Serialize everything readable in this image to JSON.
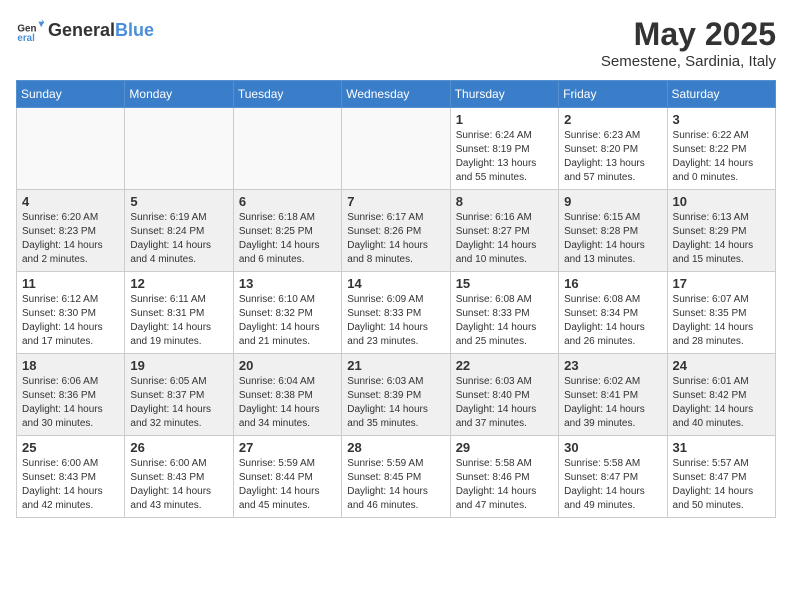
{
  "logo": {
    "general": "General",
    "blue": "Blue"
  },
  "title": "May 2025",
  "location": "Semestene, Sardinia, Italy",
  "weekdays": [
    "Sunday",
    "Monday",
    "Tuesday",
    "Wednesday",
    "Thursday",
    "Friday",
    "Saturday"
  ],
  "weeks": [
    [
      {
        "day": "",
        "info": ""
      },
      {
        "day": "",
        "info": ""
      },
      {
        "day": "",
        "info": ""
      },
      {
        "day": "",
        "info": ""
      },
      {
        "day": "1",
        "info": "Sunrise: 6:24 AM\nSunset: 8:19 PM\nDaylight: 13 hours\nand 55 minutes."
      },
      {
        "day": "2",
        "info": "Sunrise: 6:23 AM\nSunset: 8:20 PM\nDaylight: 13 hours\nand 57 minutes."
      },
      {
        "day": "3",
        "info": "Sunrise: 6:22 AM\nSunset: 8:22 PM\nDaylight: 14 hours\nand 0 minutes."
      }
    ],
    [
      {
        "day": "4",
        "info": "Sunrise: 6:20 AM\nSunset: 8:23 PM\nDaylight: 14 hours\nand 2 minutes."
      },
      {
        "day": "5",
        "info": "Sunrise: 6:19 AM\nSunset: 8:24 PM\nDaylight: 14 hours\nand 4 minutes."
      },
      {
        "day": "6",
        "info": "Sunrise: 6:18 AM\nSunset: 8:25 PM\nDaylight: 14 hours\nand 6 minutes."
      },
      {
        "day": "7",
        "info": "Sunrise: 6:17 AM\nSunset: 8:26 PM\nDaylight: 14 hours\nand 8 minutes."
      },
      {
        "day": "8",
        "info": "Sunrise: 6:16 AM\nSunset: 8:27 PM\nDaylight: 14 hours\nand 10 minutes."
      },
      {
        "day": "9",
        "info": "Sunrise: 6:15 AM\nSunset: 8:28 PM\nDaylight: 14 hours\nand 13 minutes."
      },
      {
        "day": "10",
        "info": "Sunrise: 6:13 AM\nSunset: 8:29 PM\nDaylight: 14 hours\nand 15 minutes."
      }
    ],
    [
      {
        "day": "11",
        "info": "Sunrise: 6:12 AM\nSunset: 8:30 PM\nDaylight: 14 hours\nand 17 minutes."
      },
      {
        "day": "12",
        "info": "Sunrise: 6:11 AM\nSunset: 8:31 PM\nDaylight: 14 hours\nand 19 minutes."
      },
      {
        "day": "13",
        "info": "Sunrise: 6:10 AM\nSunset: 8:32 PM\nDaylight: 14 hours\nand 21 minutes."
      },
      {
        "day": "14",
        "info": "Sunrise: 6:09 AM\nSunset: 8:33 PM\nDaylight: 14 hours\nand 23 minutes."
      },
      {
        "day": "15",
        "info": "Sunrise: 6:08 AM\nSunset: 8:33 PM\nDaylight: 14 hours\nand 25 minutes."
      },
      {
        "day": "16",
        "info": "Sunrise: 6:08 AM\nSunset: 8:34 PM\nDaylight: 14 hours\nand 26 minutes."
      },
      {
        "day": "17",
        "info": "Sunrise: 6:07 AM\nSunset: 8:35 PM\nDaylight: 14 hours\nand 28 minutes."
      }
    ],
    [
      {
        "day": "18",
        "info": "Sunrise: 6:06 AM\nSunset: 8:36 PM\nDaylight: 14 hours\nand 30 minutes."
      },
      {
        "day": "19",
        "info": "Sunrise: 6:05 AM\nSunset: 8:37 PM\nDaylight: 14 hours\nand 32 minutes."
      },
      {
        "day": "20",
        "info": "Sunrise: 6:04 AM\nSunset: 8:38 PM\nDaylight: 14 hours\nand 34 minutes."
      },
      {
        "day": "21",
        "info": "Sunrise: 6:03 AM\nSunset: 8:39 PM\nDaylight: 14 hours\nand 35 minutes."
      },
      {
        "day": "22",
        "info": "Sunrise: 6:03 AM\nSunset: 8:40 PM\nDaylight: 14 hours\nand 37 minutes."
      },
      {
        "day": "23",
        "info": "Sunrise: 6:02 AM\nSunset: 8:41 PM\nDaylight: 14 hours\nand 39 minutes."
      },
      {
        "day": "24",
        "info": "Sunrise: 6:01 AM\nSunset: 8:42 PM\nDaylight: 14 hours\nand 40 minutes."
      }
    ],
    [
      {
        "day": "25",
        "info": "Sunrise: 6:00 AM\nSunset: 8:43 PM\nDaylight: 14 hours\nand 42 minutes."
      },
      {
        "day": "26",
        "info": "Sunrise: 6:00 AM\nSunset: 8:43 PM\nDaylight: 14 hours\nand 43 minutes."
      },
      {
        "day": "27",
        "info": "Sunrise: 5:59 AM\nSunset: 8:44 PM\nDaylight: 14 hours\nand 45 minutes."
      },
      {
        "day": "28",
        "info": "Sunrise: 5:59 AM\nSunset: 8:45 PM\nDaylight: 14 hours\nand 46 minutes."
      },
      {
        "day": "29",
        "info": "Sunrise: 5:58 AM\nSunset: 8:46 PM\nDaylight: 14 hours\nand 47 minutes."
      },
      {
        "day": "30",
        "info": "Sunrise: 5:58 AM\nSunset: 8:47 PM\nDaylight: 14 hours\nand 49 minutes."
      },
      {
        "day": "31",
        "info": "Sunrise: 5:57 AM\nSunset: 8:47 PM\nDaylight: 14 hours\nand 50 minutes."
      }
    ]
  ]
}
